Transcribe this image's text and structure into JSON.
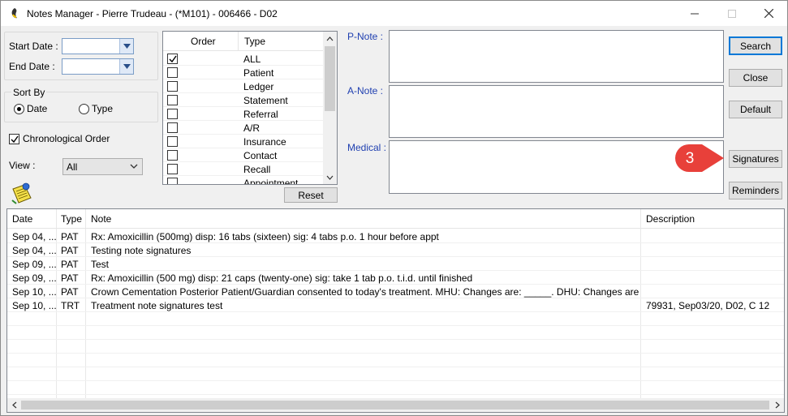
{
  "window": {
    "title": "Notes Manager - Pierre Trudeau - (*M101) - 006466 - D02",
    "minimize": "—",
    "maximize": "☐",
    "close": "✕"
  },
  "filters": {
    "start_date_label": "Start Date :",
    "end_date_label": "End Date :",
    "start_date_value": "",
    "end_date_value": "",
    "sort_by_label": "Sort By",
    "sort_date_label": "Date",
    "sort_type_label": "Type",
    "sort_selected": "Date",
    "chronological_label": "Chronological Order",
    "chronological_checked": true,
    "view_label": "View :",
    "view_value": "All"
  },
  "typelist": {
    "header_order": "Order",
    "header_type": "Type",
    "items": [
      {
        "label": "ALL",
        "checked": true
      },
      {
        "label": "Patient",
        "checked": false
      },
      {
        "label": "Ledger",
        "checked": false
      },
      {
        "label": "Statement",
        "checked": false
      },
      {
        "label": "Referral",
        "checked": false
      },
      {
        "label": "A/R",
        "checked": false
      },
      {
        "label": "Insurance",
        "checked": false
      },
      {
        "label": "Contact",
        "checked": false
      },
      {
        "label": "Recall",
        "checked": false
      },
      {
        "label": "Appointment",
        "checked": false
      }
    ],
    "reset_label": "Reset"
  },
  "notes": {
    "pnote_label": "P-Note :",
    "anote_label": "A-Note :",
    "medical_label": "Medical :",
    "pnote_value": "",
    "anote_value": "",
    "medical_value": ""
  },
  "buttons": {
    "search": "Search",
    "close": "Close",
    "default": "Default",
    "signatures": "Signatures",
    "reminders": "Reminders"
  },
  "callout": {
    "number": "3",
    "color": "#e8403a"
  },
  "grid": {
    "headers": {
      "date": "Date",
      "type": "Type",
      "note": "Note",
      "description": "Description"
    },
    "rows": [
      {
        "date": "Sep 04, ...",
        "type": "PAT",
        "note": "Rx: Amoxicillin (500mg)  disp: 16 tabs (sixteen)  sig: 4 tabs p.o. 1 hour before appt",
        "description": ""
      },
      {
        "date": "Sep 04, ...",
        "type": "PAT",
        "note": "Testing note signatures",
        "description": ""
      },
      {
        "date": "Sep 09, ...",
        "type": "PAT",
        "note": "Test",
        "description": ""
      },
      {
        "date": "Sep 09, ...",
        "type": "PAT",
        "note": "Rx: Amoxicillin  (500 mg)  disp: 21 caps (twenty-one)  sig:   take 1 tab p.o. t.i.d. until finished",
        "description": ""
      },
      {
        "date": "Sep 10, ...",
        "type": "PAT",
        "note": "Crown Cementation Posterior  Patient/Guardian consented to today's treatment. MHU: Changes are: _____. DHU: Changes are: _____.  To...",
        "description": ""
      },
      {
        "date": "Sep 10, ...",
        "type": "TRT",
        "note": "Treatment note signatures test",
        "description": "79931,  Sep03/20,  D02,  C  12"
      }
    ]
  }
}
